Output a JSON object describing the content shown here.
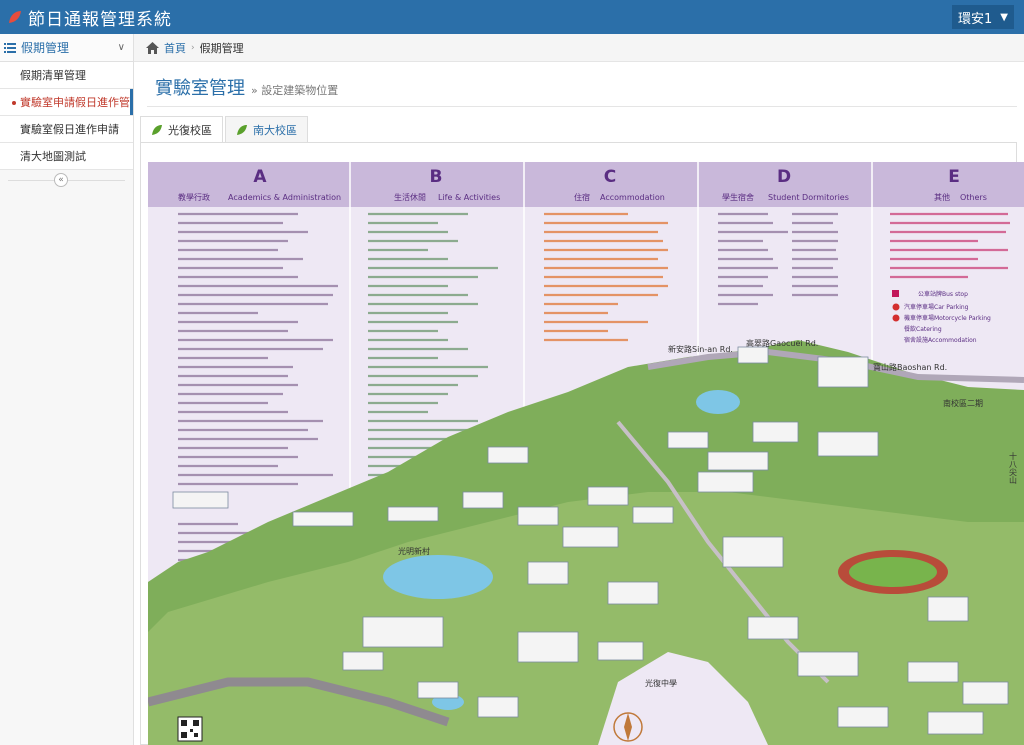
{
  "app": {
    "title": "節日通報管理系統",
    "user": "環安1"
  },
  "sidebar": {
    "group": "假期管理",
    "items": [
      {
        "label": "假期清單管理",
        "active": false
      },
      {
        "label": "實驗室申請假日進作管理",
        "active": true
      },
      {
        "label": "實驗室假日進作申請",
        "active": false
      },
      {
        "label": "清大地圖測試",
        "active": false
      }
    ],
    "collapse": "«"
  },
  "breadcrumb": {
    "home": "首頁",
    "current": "假期管理"
  },
  "page": {
    "title": "實驗室管理",
    "subtitle": "» 設定建築物位置"
  },
  "tabs": [
    {
      "label": "光復校區",
      "active": true
    },
    {
      "label": "南大校區",
      "active": false
    }
  ],
  "map": {
    "columns": [
      {
        "letter": "A",
        "zh": "教學行政",
        "en": "Academics & Administration"
      },
      {
        "letter": "B",
        "zh": "生活休閒",
        "en": "Life & Activities"
      },
      {
        "letter": "C",
        "zh": "住宿",
        "en": "Accommodation"
      },
      {
        "letter": "D",
        "zh": "學生宿舍",
        "en": "Student Dormitories"
      },
      {
        "letter": "E",
        "zh": "其他",
        "en": "Others"
      }
    ],
    "labels": {
      "road1": "新安路Sin-an Rd.",
      "road2": "高翠路Gaocuei Rd.",
      "road3": "寶山路Baoshan Rd.",
      "south": "南校區二期",
      "village": "光明新村",
      "school": "光復中學",
      "tower": "十八尖山"
    },
    "legend": [
      "公車站牌Bus stop",
      "汽車停車場Car Parking",
      "機車停車場Motorcycle Parking",
      "餐飲Catering",
      "宿舍設施Accommodation"
    ]
  }
}
